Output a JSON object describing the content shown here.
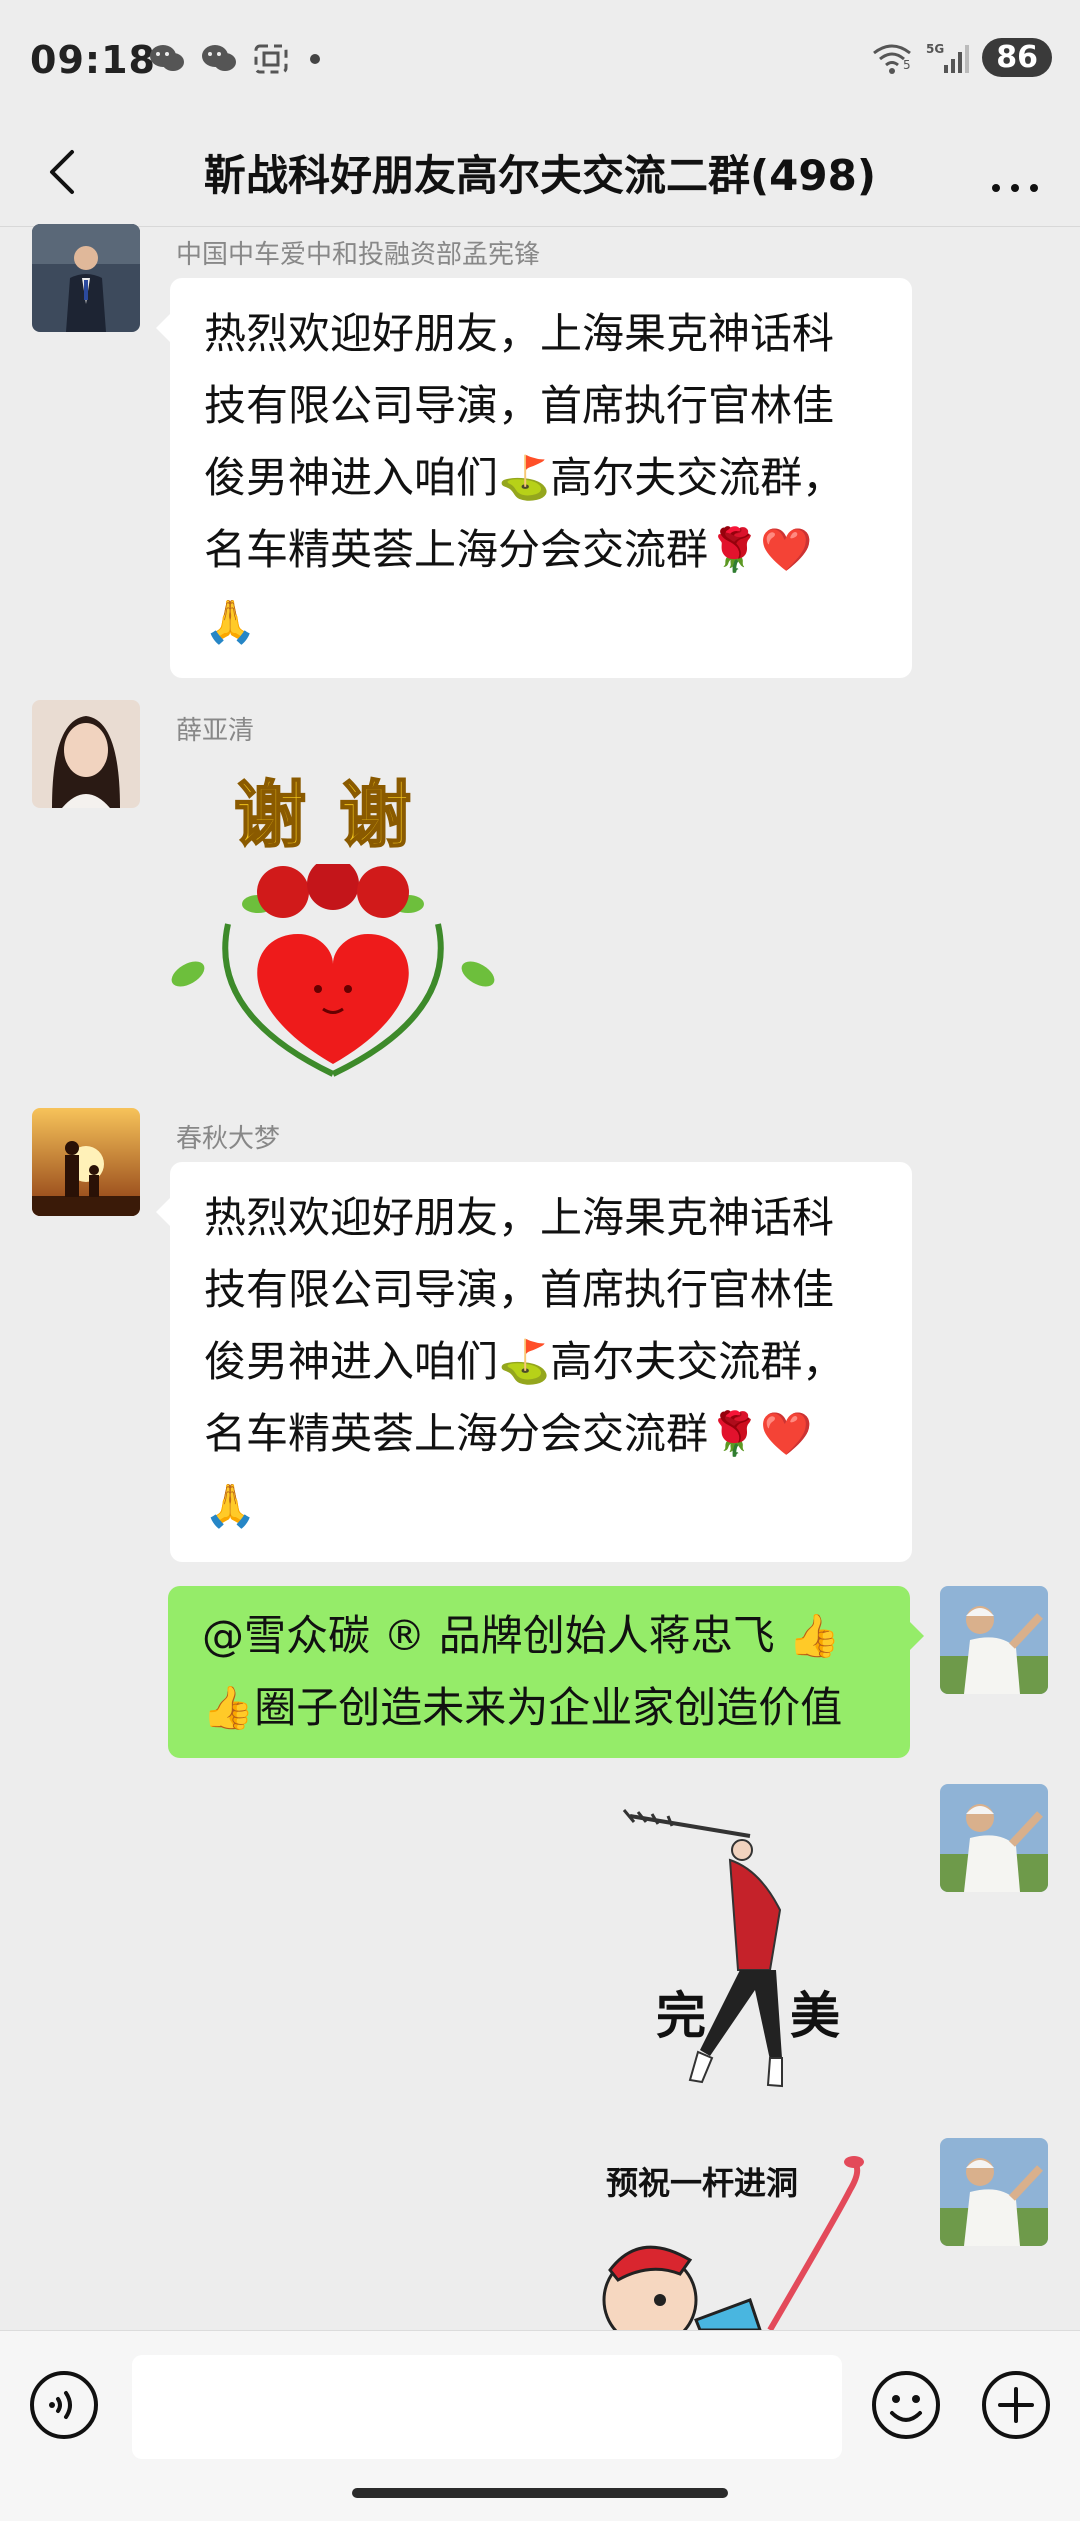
{
  "status_bar": {
    "time": "09:18",
    "signal": "5G",
    "wifi_sub": "5",
    "battery": "86"
  },
  "header": {
    "title": "靳战科好朋友高尔夫交流二群(498)"
  },
  "messages": [
    {
      "sender": "中国中车爱中和投融资部孟宪锋",
      "lines": [
        "热烈欢迎好朋友，上海果克神话科",
        "技有限公司导演，首席执行官林佳",
        "俊男神进入咱们⛳高尔夫交流群，",
        "名车精英荟上海分会交流群🌹❤️",
        "🙏"
      ]
    },
    {
      "sender": "薛亚清",
      "sticker_text": "谢 谢"
    },
    {
      "sender": "春秋大梦",
      "lines": [
        "热烈欢迎好朋友，上海果克神话科",
        "技有限公司导演，首席执行官林佳",
        "俊男神进入咱们⛳高尔夫交流群，",
        "名车精英荟上海分会交流群🌹❤️",
        "🙏"
      ]
    },
    {
      "sender": "",
      "lines": [
        "@雪众碳 ® 品牌创始人蒋忠飞 👍",
        "👍圈子创造未来为企业家创造价值"
      ]
    },
    {
      "sticker_text_left": "完",
      "sticker_text_right": "美"
    },
    {
      "sticker_text": "预祝一杆进洞"
    }
  ],
  "colors": {
    "background": "#ededed",
    "bubble_self": "#95ec69",
    "bubble_other": "#ffffff"
  }
}
